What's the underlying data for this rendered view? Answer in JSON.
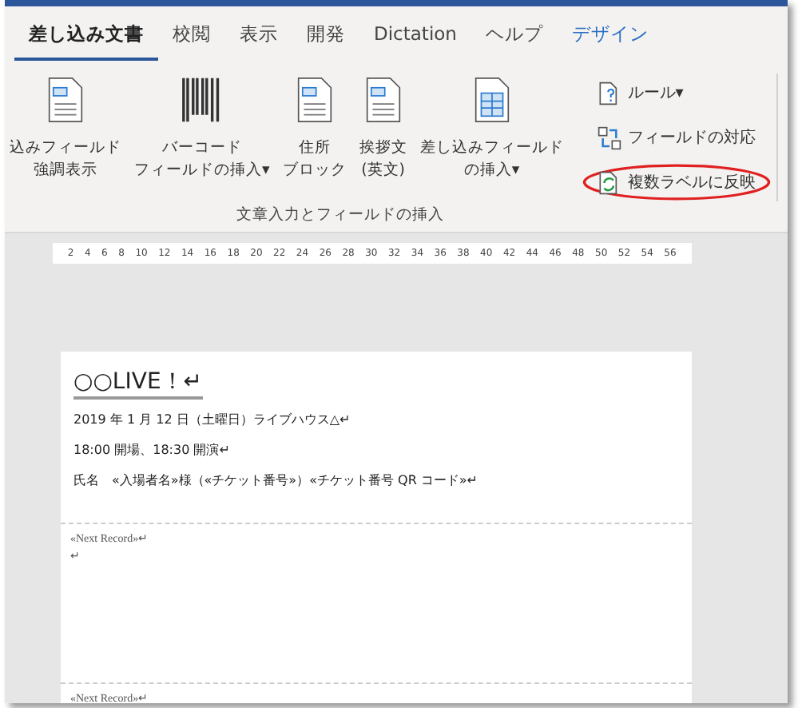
{
  "tabs": [
    {
      "label": "差し込み文書",
      "selected": true,
      "kind": "normal"
    },
    {
      "label": "校閲",
      "selected": false,
      "kind": "normal"
    },
    {
      "label": "表示",
      "selected": false,
      "kind": "normal"
    },
    {
      "label": "開発",
      "selected": false,
      "kind": "normal"
    },
    {
      "label": "Dictation",
      "selected": false,
      "kind": "normal"
    },
    {
      "label": "ヘルプ",
      "selected": false,
      "kind": "normal"
    },
    {
      "label": "デザイン",
      "selected": false,
      "kind": "contextual"
    }
  ],
  "ribbon": {
    "caret": "▾",
    "large_buttons": [
      {
        "kind": "doc",
        "lines": [
          "込みフィールド",
          "強調表示"
        ],
        "dropdown": false
      },
      {
        "kind": "barcode",
        "lines": [
          "バーコード",
          "フィールドの挿入"
        ],
        "dropdown": true
      },
      {
        "kind": "doc",
        "lines": [
          "住所",
          "ブロック"
        ],
        "dropdown": false
      },
      {
        "kind": "doc",
        "lines": [
          "挨拶文",
          "(英文)"
        ],
        "dropdown": false
      },
      {
        "kind": "table",
        "lines": [
          "差し込みフィールド",
          "の挿入"
        ],
        "dropdown": true
      }
    ],
    "small_buttons": [
      {
        "kind": "rules",
        "label": "ルール",
        "dropdown": true,
        "highlighted": false
      },
      {
        "kind": "match",
        "label": "フィールドの対応",
        "dropdown": false,
        "highlighted": false
      },
      {
        "kind": "update",
        "label": "複数ラベルに反映",
        "dropdown": false,
        "highlighted": true
      }
    ],
    "group_label": "文章入力とフィールドの挿入"
  },
  "ruler": [
    "2",
    "4",
    "6",
    "8",
    "10",
    "12",
    "14",
    "16",
    "18",
    "20",
    "22",
    "24",
    "26",
    "28",
    "30",
    "32",
    "34",
    "36",
    "38",
    "40",
    "42",
    "44",
    "46",
    "48",
    "50",
    "52",
    "54",
    "56"
  ],
  "document": {
    "title": "○○LIVE！↵",
    "records": [
      {
        "lines": [
          "2019 年 1 月 12 日（土曜日）ライブハウス△↵",
          "18:00 開場、18:30 開演↵",
          "氏名　«入場者名»様（«チケット番号»）«チケット番号 QR コード»↵"
        ]
      },
      {
        "lines": [
          "«Next Record»↵",
          "↵"
        ]
      },
      {
        "lines": [
          "«Next Record»↵"
        ]
      }
    ]
  }
}
